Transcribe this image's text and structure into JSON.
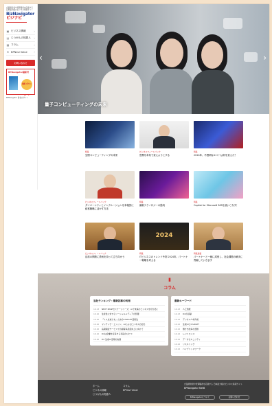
{
  "brand": {
    "tagline": "企業経営者や管理職者を応援する 日本最大級のビジネス情報サイト",
    "logo_main": "BizNavigator",
    "logo_sub": "ビジナビ"
  },
  "sidebar": {
    "items": [
      {
        "icon": "briefcase-icon",
        "label": "ビジネス情報"
      },
      {
        "icon": "building-icon",
        "label": "じつがんの知恵人"
      },
      {
        "icon": "document-icon",
        "label": "コラム"
      },
      {
        "icon": "star-icon",
        "label": "BPNavi Value"
      }
    ],
    "cta": "お問い合わせ",
    "promo": {
      "title": "BPNavigator最新号",
      "badge": "無料 ダウンロード",
      "footer": "BPNavigator 各社のサイト"
    }
  },
  "hero": {
    "caption": "量子コンピューティングの未来"
  },
  "articles": [
    {
      "cat": "特集",
      "title": "空間コンピューティングの未来"
    },
    {
      "cat": "ビジネスフィードバック",
      "title": "営業を本気で変えようとする"
    },
    {
      "cat": "特集",
      "title": "2024年、不透明なエコーは何を変えた？"
    },
    {
      "cat": "ビジネスフィードバック",
      "title": "ダイバーシティとインクルージョンを本格的に経営戦略に活かす方法"
    },
    {
      "cat": "特集",
      "title": "最新テクノロジーの動向"
    },
    {
      "cat": "特集",
      "title": "Copilot for Microsoft 365を使いこなす！"
    },
    {
      "cat": "ビジネスフィードバック",
      "title": "目前の問題に勇気を持って立ち向かう"
    },
    {
      "cat": "特集",
      "title": "ITビジネスのトレンド予測 2024年、パートナー戦略を考える"
    },
    {
      "cat": "特集連載",
      "title": "パートナーと一緒に成長し、社会課題の解決に貢献していきます"
    }
  ],
  "columns": {
    "title": "コラム",
    "left_heading": "当社ランキング・最新記事の利用",
    "left_rows": [
      {
        "d": "10.13",
        "t": "NEXT BASEセミナーシリーズ：AIで未来のビジネスを切り拓く"
      },
      {
        "d": "10.10",
        "t": "生産性に対するソーシャルメディアの影響"
      },
      {
        "d": "10.10",
        "t": "「ミスを減らす」ためのChatGPT活用法"
      },
      {
        "d": "10.10",
        "t": "マッチング・エンジン、AIによるビジネスの変化"
      },
      {
        "d": "10.10",
        "t": "長期保証サービスでの顧客満足度向上に向けて"
      },
      {
        "d": "10.10",
        "t": "DXは企業を変革する手段のひとつ"
      },
      {
        "d": "10.10",
        "t": "DX 生成AI活用の実践"
      }
    ],
    "right_heading": "最新キーワード",
    "right_rows": [
      {
        "d": "10.13",
        "t": "人工知能"
      },
      {
        "d": "10.13",
        "t": "DXの基礎"
      },
      {
        "d": "10.12",
        "t": "デジタル人材育成"
      },
      {
        "d": "10.12",
        "t": "生成AIとChatGPT"
      },
      {
        "d": "10.12",
        "t": "働き方改革の課題"
      },
      {
        "d": "10.12",
        "t": "レジリエンス"
      },
      {
        "d": "10.12",
        "t": "データセキュリティ"
      },
      {
        "d": "10.12",
        "t": "リスキリング"
      },
      {
        "d": "10.12",
        "t": "ハイブリッドワーク"
      }
    ]
  },
  "footer": {
    "col1": [
      "ホーム",
      "ビジネス情報",
      "じつがんの知恵人"
    ],
    "col2": [
      "コラム",
      "BPNavi Value"
    ],
    "about": "企業経営者や管理職者を応援する 日本最大級のビジネス情報サイト",
    "logo": "BPNavigator NetB",
    "btn1": "BPNavigatorについて",
    "btn2": "お問い合わせ"
  },
  "colors": {
    "accent": "#d92b2b",
    "brand_blue": "#1b3d8f",
    "page_bg": "#f6e3cb",
    "footer_bg": "#3c3c3c"
  }
}
